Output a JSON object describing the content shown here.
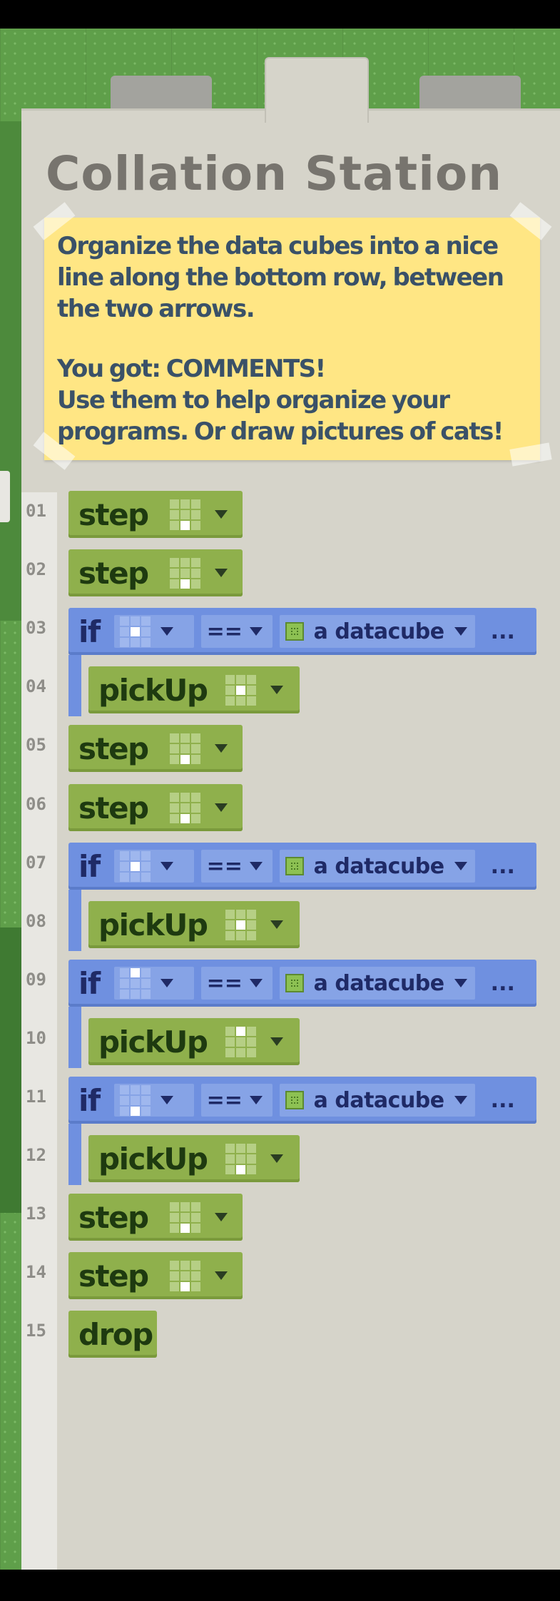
{
  "title": "Collation Station",
  "note": {
    "line1": "Organize the data cubes into a nice line along the bottom row, between the two arrows.",
    "line2": "You got: COMMENTS!",
    "line3": "Use them to help organize your programs. Or draw pictures of cats!"
  },
  "lines": [
    "01",
    "02",
    "03",
    "04",
    "05",
    "06",
    "07",
    "08",
    "09",
    "10",
    "11",
    "12",
    "13",
    "14",
    "15"
  ],
  "program": [
    {
      "kw": "step",
      "grid": "bottom-center"
    },
    {
      "kw": "step",
      "grid": "bottom-center"
    },
    {
      "kw": "if",
      "grid": "center",
      "op": "==",
      "target": "a datacube",
      "more": "..."
    },
    {
      "kw": "pickUp",
      "grid": "center"
    },
    {
      "kw": "step",
      "grid": "bottom-center"
    },
    {
      "kw": "step",
      "grid": "bottom-center"
    },
    {
      "kw": "if",
      "grid": "center",
      "op": "==",
      "target": "a datacube",
      "more": "..."
    },
    {
      "kw": "pickUp",
      "grid": "center"
    },
    {
      "kw": "if",
      "grid": "top-center",
      "op": "==",
      "target": "a datacube",
      "more": "..."
    },
    {
      "kw": "pickUp",
      "grid": "top-center"
    },
    {
      "kw": "if",
      "grid": "bottom-center",
      "op": "==",
      "target": "a datacube",
      "more": "..."
    },
    {
      "kw": "pickUp",
      "grid": "bottom-center"
    },
    {
      "kw": "step",
      "grid": "bottom-center"
    },
    {
      "kw": "step",
      "grid": "bottom-center"
    },
    {
      "kw": "drop"
    }
  ],
  "colors": {
    "action": "#8fb04c",
    "condition": "#6f90e0",
    "note": "#ffe684",
    "panel": "#d6d4ca"
  }
}
